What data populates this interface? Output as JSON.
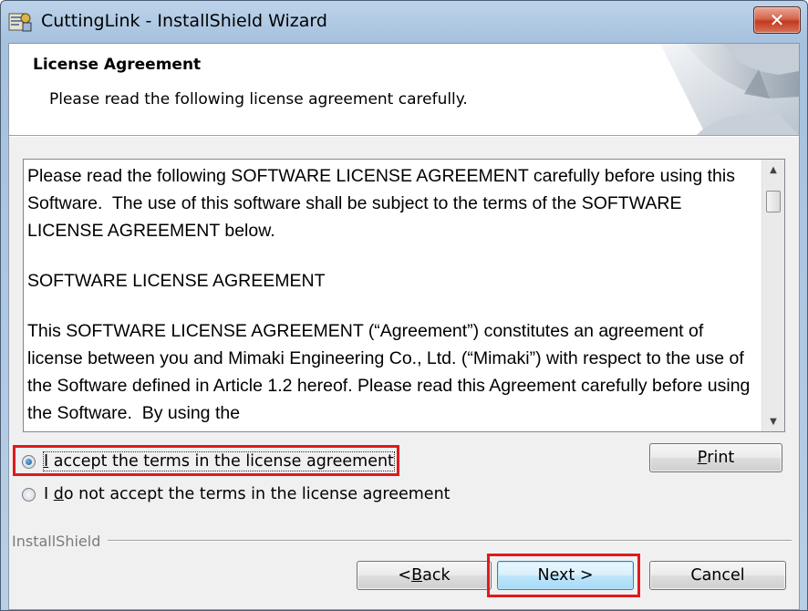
{
  "window": {
    "title": "CuttingLink - InstallShield Wizard",
    "close_glyph": "✕"
  },
  "banner": {
    "title": "License Agreement",
    "subtitle": "Please read the following license agreement carefully."
  },
  "license": {
    "paragraphs": [
      "Please read the following SOFTWARE LICENSE AGREEMENT carefully before using this Software.  The use of this software shall be subject to the terms of the SOFTWARE LICENSE AGREEMENT below.",
      "SOFTWARE LICENSE AGREEMENT",
      "This SOFTWARE LICENSE AGREEMENT (“Agreement”) constitutes an agreement of license between you and Mimaki Engineering Co., Ltd. (“Mimaki”) with respect to the use of the Software defined in Article 1.2 hereof. Please read this Agreement carefully before using the Software.  By using the"
    ]
  },
  "options": {
    "accept": {
      "access_key": "I",
      "rest": " accept the terms in the license agreement",
      "selected": true
    },
    "decline": {
      "prefix": "I ",
      "access_key": "d",
      "rest": "o not accept the terms in the license agreement",
      "selected": false
    }
  },
  "buttons": {
    "print": {
      "access_key": "P",
      "rest": "rint"
    },
    "back": {
      "prefix": "< ",
      "access_key": "B",
      "rest": "ack"
    },
    "next": {
      "label": "Next >"
    },
    "cancel": {
      "label": "Cancel"
    }
  },
  "footer": {
    "brand": "InstallShield"
  },
  "colors": {
    "highlight": "#e0191f",
    "radio_selected": "#1c5c9c",
    "close_button": "#c3391e"
  }
}
